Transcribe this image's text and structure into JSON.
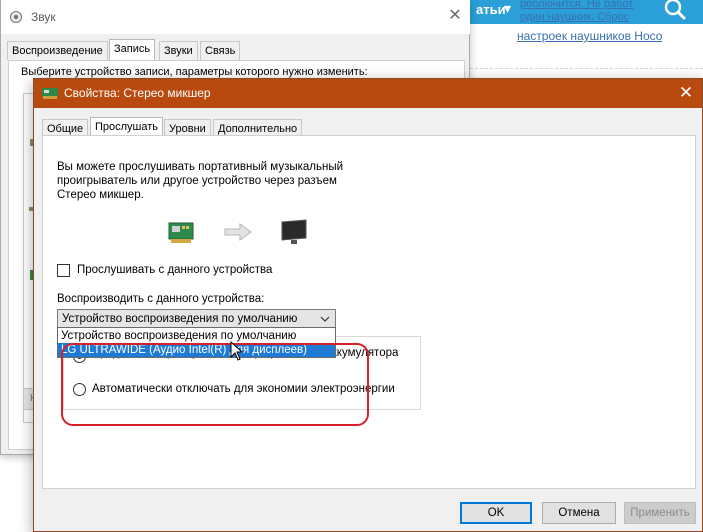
{
  "web": {
    "header_text": "атьи",
    "link_a": "роблючится, Не работ",
    "link_b": "один наушник. Сброс",
    "link_c": "настроек наушников Носо"
  },
  "sound_window": {
    "title": "Звук",
    "close_label": "✕",
    "tabs": [
      "Воспроизведение",
      "Запись",
      "Звуки",
      "Связь"
    ],
    "active_tab": "Запись",
    "prompt": "Выберите устройство записи, параметры которого нужно изменить:"
  },
  "properties_dialog": {
    "title": "Свойства: Стерео микшер",
    "close_label": "✕",
    "tabs": [
      "Общие",
      "Прослушать",
      "Уровни",
      "Дополнительно"
    ],
    "active_tab": "Прослушать",
    "description": "Вы можете прослушивать портативный музыкальный проигрыватель или другое устройство через разъем Стерео микшер.",
    "listen_checkbox": {
      "label": "Прослушивать с данного устройства",
      "checked": false
    },
    "playback_label": "Воспроизводить с данного устройства:",
    "playback_selected": "Устройство воспроизведения по умолчанию",
    "playback_options": [
      "Устройство воспроизведения по умолчанию",
      "LG ULTRAWIDE (Аудио Intel(R) для дисплеев)"
    ],
    "highlighted_option": "LG ULTRAWIDE (Аудио Intel(R) для дисплеев)",
    "power_options": [
      {
        "label": "Продолжать прослушивание при работе от аккумулятора",
        "selected": true
      },
      {
        "label": "Автоматически отключать для экономии электроэнергии",
        "selected": false
      }
    ],
    "buttons": {
      "ok": "OK",
      "cancel": "Отмена",
      "apply": "Применить"
    }
  },
  "colors": {
    "dialog_titlebar": "#b84a10",
    "selection": "#1f7ad6",
    "highlight_ring": "#d6202a",
    "web_header": "#2a9fd8"
  }
}
